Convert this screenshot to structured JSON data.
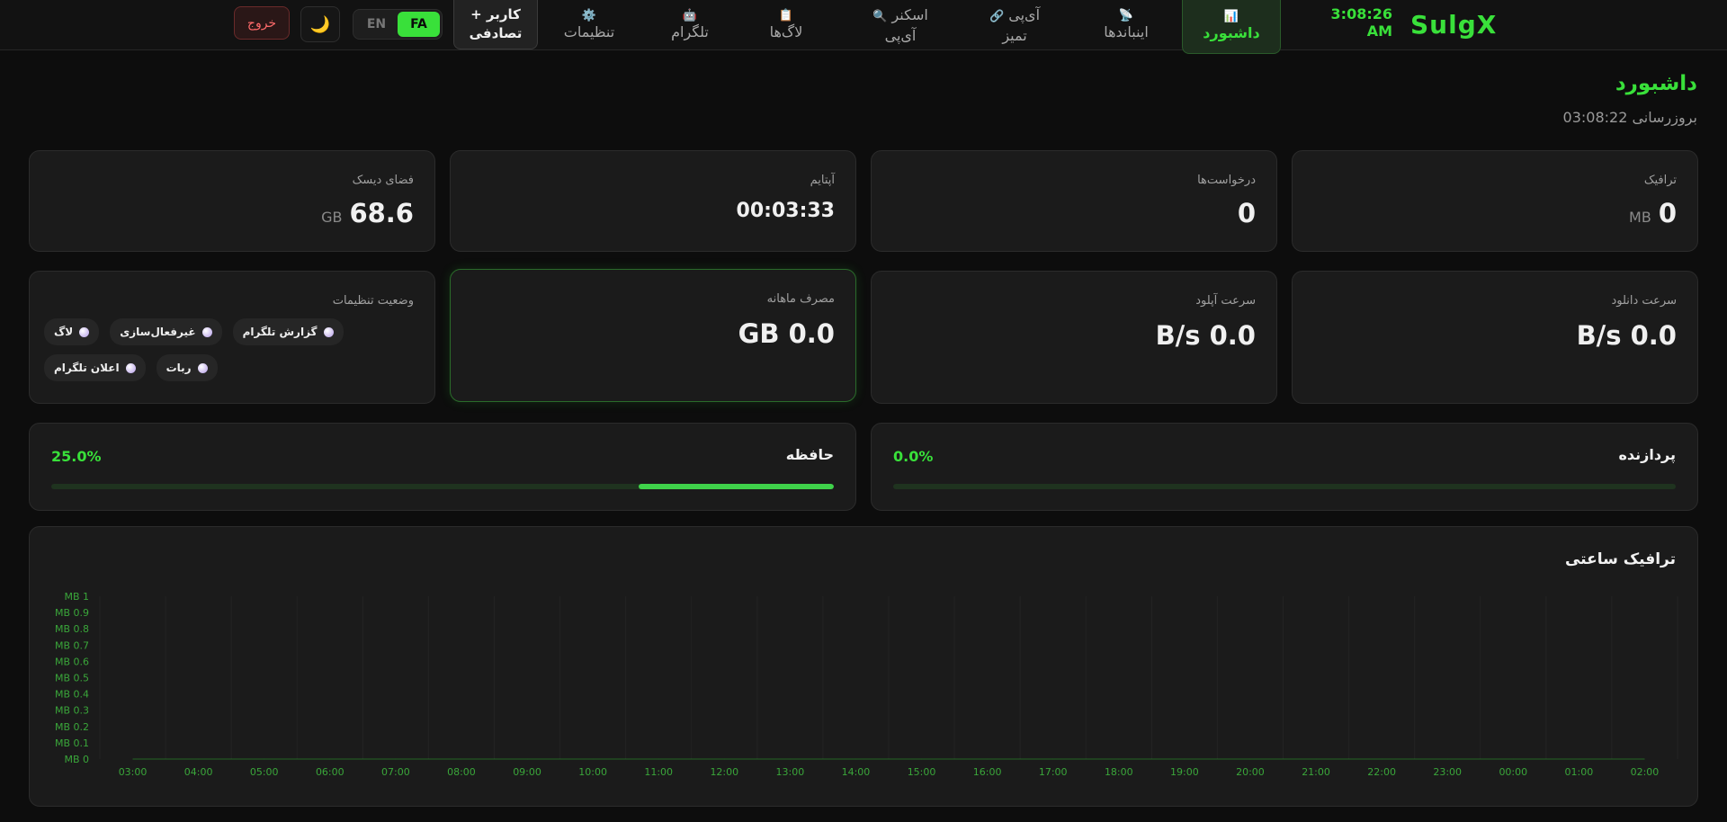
{
  "nav": {
    "brand": "SulgX",
    "clock_time": "3:08:26",
    "clock_ampm": "AM",
    "items": [
      {
        "icon": "📊",
        "label": "داشبورد"
      },
      {
        "icon": "📡",
        "label": "اینباندها"
      },
      {
        "icon": "🔗",
        "label1": "آی‌پی",
        "label2": "تمیز"
      },
      {
        "icon": "🔍",
        "label1": "اسکنر",
        "label2": "آی‌پی"
      },
      {
        "icon": "📋",
        "label": "لاگ‌ها"
      },
      {
        "icon": "🤖",
        "label": "تلگرام"
      },
      {
        "icon": "⚙️",
        "label": "تنظیمات"
      },
      {
        "label1": "+ کاربر",
        "label2": "تصادفی"
      }
    ],
    "lang_fa": "FA",
    "lang_en": "EN",
    "theme_icon": "🌙",
    "logout": "خروج"
  },
  "page": {
    "title": "داشبورد",
    "updated": "بروزرسانی 03:08:22"
  },
  "stats": {
    "traffic": {
      "label": "ترافیک",
      "value": "0",
      "unit": "MB"
    },
    "requests": {
      "label": "درخواست‌ها",
      "value": "0"
    },
    "uptime": {
      "label": "آپتایم",
      "value": "00:03:33"
    },
    "disk": {
      "label": "فضای دیسک",
      "value": "68.6",
      "unit": "GB"
    },
    "download": {
      "label": "سرعت دانلود",
      "value": "B/s 0.0"
    },
    "upload": {
      "label": "سرعت آپلود",
      "value": "B/s 0.0"
    },
    "monthly": {
      "label": "مصرف ماهانه",
      "value": "GB 0.0"
    },
    "settings_status": {
      "label": "وضعیت تنظیمات",
      "badges": [
        "لاگ",
        "غیرفعال‌سازی",
        "گزارش تلگرام",
        "اعلان تلگرام",
        "ربات"
      ]
    }
  },
  "cpu": {
    "label": "پردازنده",
    "percent_text": "0.0%",
    "percent": 0.0
  },
  "memory": {
    "label": "حافظه",
    "percent_text": "25.0%",
    "percent": 25.0
  },
  "chart_data": {
    "type": "area",
    "title": "ترافیک ساعتی",
    "x": [
      "03:00",
      "04:00",
      "05:00",
      "06:00",
      "07:00",
      "08:00",
      "09:00",
      "10:00",
      "11:00",
      "12:00",
      "13:00",
      "14:00",
      "15:00",
      "16:00",
      "17:00",
      "18:00",
      "19:00",
      "20:00",
      "21:00",
      "22:00",
      "23:00",
      "00:00",
      "01:00",
      "02:00"
    ],
    "values": [
      0,
      0,
      0,
      0,
      0,
      0,
      0,
      0,
      0,
      0,
      0,
      0,
      0,
      0,
      0,
      0,
      0,
      0,
      0,
      0,
      0,
      0,
      0,
      0
    ],
    "ylim": [
      0,
      1
    ],
    "yticks": [
      "MB 0",
      "MB 0.1",
      "MB 0.2",
      "MB 0.3",
      "MB 0.4",
      "MB 0.5",
      "MB 0.6",
      "MB 0.7",
      "MB 0.8",
      "MB 0.9",
      "MB 1"
    ],
    "grid": true,
    "color": "#39e03a"
  },
  "colors": {
    "accent": "#39e03a",
    "danger": "#ff6b6b"
  }
}
